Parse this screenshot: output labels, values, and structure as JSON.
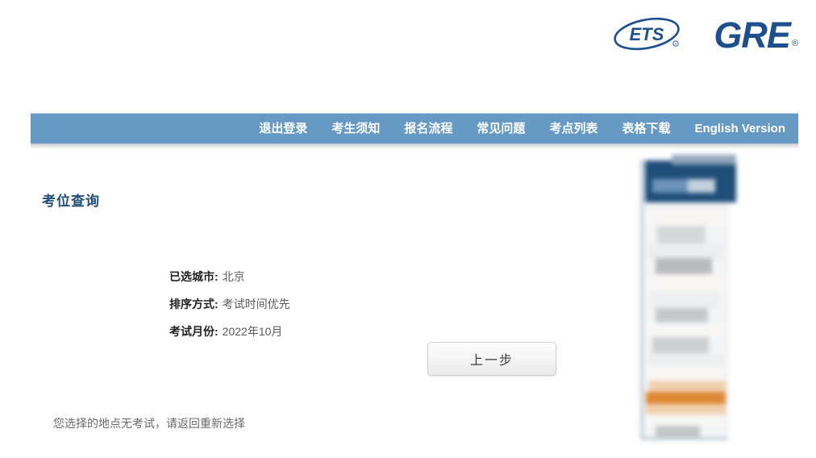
{
  "header": {
    "ets_logo_alt": "ETS",
    "ets_logo_text": "ETS",
    "gre_logo_text": "GRE",
    "gre_registered_mark": "®"
  },
  "nav": {
    "items": [
      {
        "label": "退出登录",
        "name": "nav-logout"
      },
      {
        "label": "考生须知",
        "name": "nav-test-taker-notice"
      },
      {
        "label": "报名流程",
        "name": "nav-registration-process"
      },
      {
        "label": "常见问题",
        "name": "nav-faq"
      },
      {
        "label": "考点列表",
        "name": "nav-test-center-list"
      },
      {
        "label": "表格下载",
        "name": "nav-form-download"
      },
      {
        "label": "English Version",
        "name": "nav-english-version"
      }
    ]
  },
  "main": {
    "page_title": "考位查询",
    "fields": [
      {
        "label": "已选城市:",
        "value": "北京"
      },
      {
        "label": "排序方式:",
        "value": "考试时间优先"
      },
      {
        "label": "考试月份:",
        "value": "2022年10月"
      }
    ],
    "back_button_label": "上一步",
    "notice": "您选择的地点无考试，请返回重新选择"
  },
  "colors": {
    "nav_background": "#6699c4",
    "title_blue": "#1f4e79",
    "brand_blue": "#1d4f8f",
    "panel_header": "#1f4e79",
    "panel_accent_orange": "#dd8833"
  }
}
